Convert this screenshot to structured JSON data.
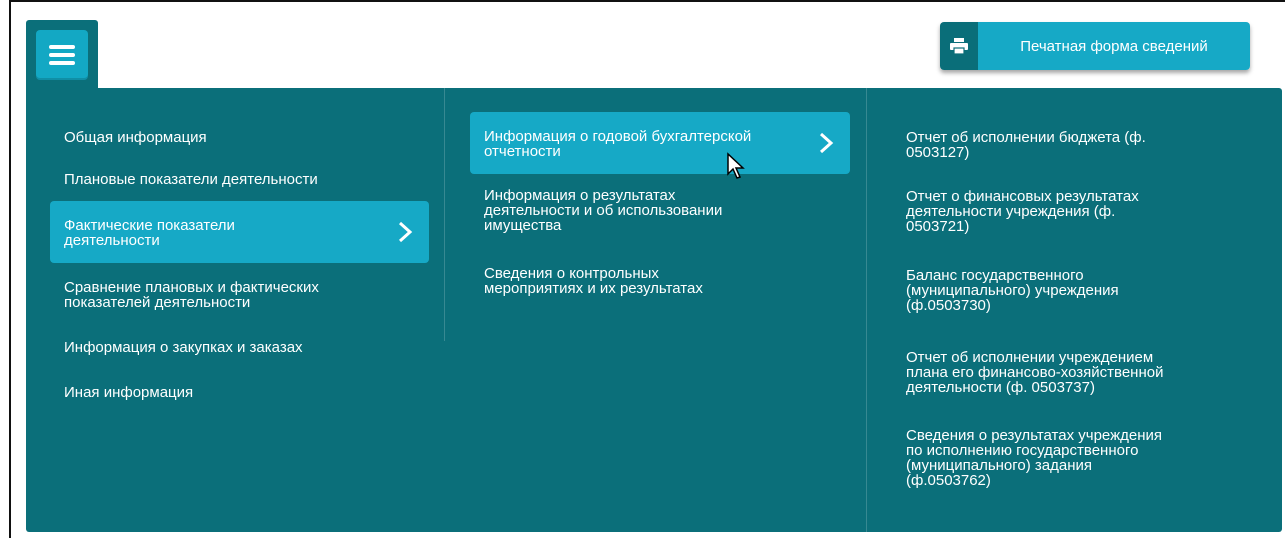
{
  "print_button": {
    "label": "Печатная форма сведений",
    "icon": "printer-icon"
  },
  "menu_button": {
    "icon": "hamburger-menu-icon"
  },
  "column1": {
    "items": [
      {
        "label": "Общая информация"
      },
      {
        "label": "Плановые показатели деятельности"
      },
      {
        "label": "Фактические показатели\nдеятельности",
        "active": true
      },
      {
        "label": "Сравнение плановых и фактических\nпоказателей деятельности"
      },
      {
        "label": "Информация о закупках и заказах"
      },
      {
        "label": "Иная информация"
      }
    ]
  },
  "column2": {
    "items": [
      {
        "label": "Информация о годовой бухгалтерской\nотчетности",
        "active": true
      },
      {
        "label": "Информация о результатах\nдеятельности и об использовании\nимущества"
      },
      {
        "label": "Сведения о контрольных\nмероприятиях и их результатах"
      }
    ]
  },
  "column3": {
    "items": [
      {
        "label": "Отчет об исполнении бюджета (ф.\n0503127)"
      },
      {
        "label": "Отчет о финансовых результатах\nдеятельности учреждения (ф.\n0503721)"
      },
      {
        "label": "Баланс государственного\n(муниципального) учреждения\n(ф.0503730)"
      },
      {
        "label": "Отчет об исполнении учреждением\nплана его финансово-хозяйственной\nдеятельности (ф. 0503737)"
      },
      {
        "label": "Сведения о результатах учреждения\nпо исполнению государственного\n(муниципального) задания\n(ф.0503762)"
      }
    ]
  },
  "colors": {
    "panel": "#0b6f7a",
    "active": "#16a9c6",
    "text": "#ffffff"
  }
}
